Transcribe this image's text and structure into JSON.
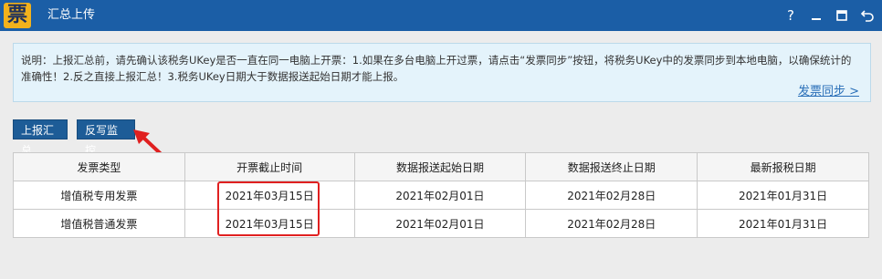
{
  "app": {
    "logo_char": "票",
    "title": "汇总上传",
    "icons": [
      "help-icon",
      "minimize-icon",
      "maximize-icon",
      "back-icon"
    ]
  },
  "notice": {
    "text": "说明：上报汇总前，请先确认该税务UKey是否一直在同一电脑上开票：1.如果在多台电脑上开过票，请点击“发票同步”按钮，将税务UKey中的发票同步到本地电脑，以确保统计的准确性！2.反之直接上报汇总！3.税务UKey日期大于数据报送起始日期才能上报。",
    "sync_link": "发票同步 >"
  },
  "buttons": {
    "summary": "上报汇总",
    "monitor": "反写监控"
  },
  "table": {
    "headers": [
      "发票类型",
      "开票截止时间",
      "数据报送起始日期",
      "数据报送终止日期",
      "最新报税日期"
    ],
    "rows": [
      [
        "增值税专用发票",
        "2021年03月15日",
        "2021年02月01日",
        "2021年02月28日",
        "2021年01月31日"
      ],
      [
        "增值税普通发票",
        "2021年03月15日",
        "2021年02月01日",
        "2021年02月28日",
        "2021年01月31日"
      ]
    ]
  },
  "colors": {
    "titlebar": "#1b5ea6",
    "button": "#1d5c97",
    "highlight": "#e02020"
  }
}
